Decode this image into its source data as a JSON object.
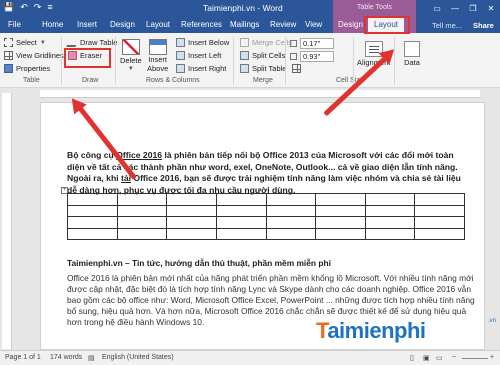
{
  "app": {
    "window_title": "Taimienphi.vn - Word",
    "context_group": "Table Tools",
    "qat": [
      "💾",
      "↶",
      "↷",
      "≡"
    ],
    "window_buttons": [
      "▭",
      "—",
      "❐",
      "✕"
    ]
  },
  "tabs": {
    "file": "File",
    "home": "Home",
    "insert": "Insert",
    "design": "Design",
    "layout": "Layout",
    "references": "References",
    "mailings": "Mailings",
    "review": "Review",
    "view": "View",
    "table_design": "Design",
    "table_layout": "Layout",
    "tell_me": "Tell me...",
    "share": "Share"
  },
  "ribbon": {
    "table_group": {
      "label": "Table",
      "select": "Select",
      "view_gridlines": "View Gridlines",
      "properties": "Properties"
    },
    "draw_group": {
      "label": "Draw",
      "draw_table": "Draw Table",
      "eraser": "Eraser"
    },
    "rows_columns_group": {
      "label": "Rows & Columns",
      "delete": "Delete",
      "insert_above_line1": "Insert",
      "insert_above_line2": "Above",
      "insert_below": "Insert Below",
      "insert_left": "Insert Left",
      "insert_right": "Insert Right"
    },
    "merge_group": {
      "label": "Merge",
      "merge_cells": "Merge Cells",
      "split_cells": "Split Cells",
      "split_table": "Split Table"
    },
    "cell_size_group": {
      "label": "Cell Size",
      "height": "0.17\"",
      "width": "0.93\""
    },
    "alignment": "Alignment",
    "data": "Data"
  },
  "document": {
    "para1_prefix": "Bộ công cụ ",
    "para1_link": "Office 2016",
    "para1_mid": " là phiên bản tiếp nối bộ Office 2013 của Microsoft với các đổi mới toàn diện về tất cả các thành phần như word, exel, OneNote, Outlook... cả về giao diện lẫn tính năng. Ngoài ra, khi ",
    "para1_tai": "tải",
    "para1_suffix": " Office 2016, bạn sẽ được trải nghiệm tính năng làm việc nhóm và chia sẻ tài liệu dễ dàng hơn, phục vụ được tối đa nhu cầu người dùng.",
    "table_handle": "+",
    "table_rows": 4,
    "table_cols": 8,
    "heading": "Taimienphi.vn – Tin tức, hướng dẫn thủ thuật, phần mềm miễn phí",
    "para2": "Office 2016 là phiên bản mới nhất của hãng phát triển phần mềm khổng lồ Microsoft. Với nhiều tính năng mới được cập nhật, đặc biệt đó là tích hợp tính năng Lync và Skype dành cho các doanh nghiệp. Office 2016 vẫn bao gồm các bộ office như: Word, Microsoft Office Excel, PowerPoint ... những được tích hợp nhiều tính năng bổ sung, hiệu quả hơn. Và hơn nữa, Microsoft Office 2016 chắc chắn sẽ được thiết kế để sử dụng hiệu quả hơn trong hệ điều hành Windows 10."
  },
  "watermark": {
    "letter": "T",
    "rest": "aimienphi",
    "suffix": ".vn"
  },
  "status": {
    "page": "Page 1 of 1",
    "words": "174 words",
    "language": "English (United States)"
  },
  "colors": {
    "accent": "#2b579a",
    "table_tools": "#9a5b97",
    "highlight": "#e0332f"
  }
}
